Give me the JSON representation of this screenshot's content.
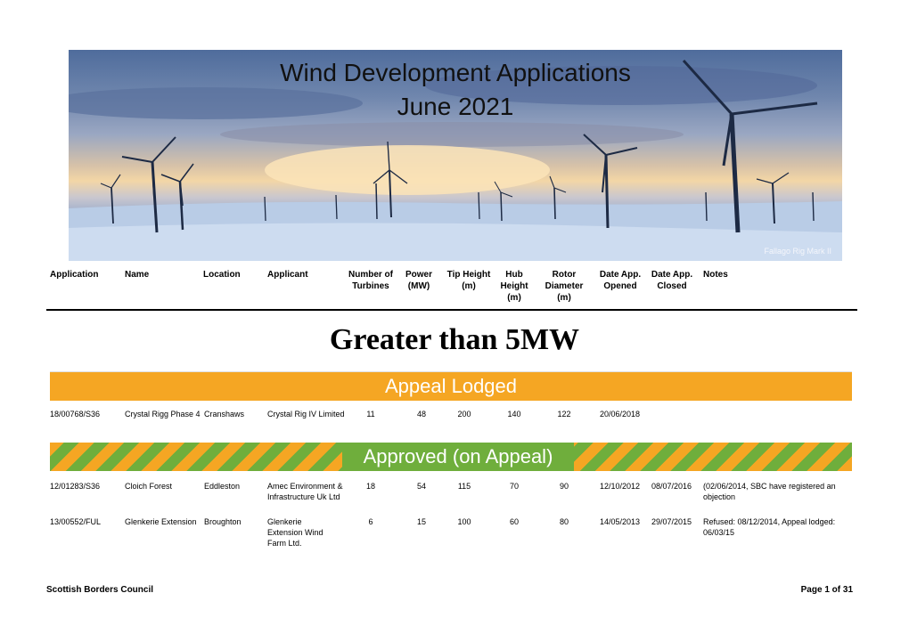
{
  "banner": {
    "title_line1": "Wind Development Applications",
    "title_line2": "June 2021",
    "caption": "Fallago Rig Mark II"
  },
  "columns": {
    "application": "Application",
    "name": "Name",
    "location": "Location",
    "applicant": "Applicant",
    "turbines": "Number of Turbines",
    "power": "Power (MW)",
    "tip": "Tip Height (m)",
    "hub": "Hub Height (m)",
    "rotor": "Rotor Diameter (m)",
    "opened": "Date App. Opened",
    "closed": "Date App. Closed",
    "notes": "Notes"
  },
  "section_title": "Greater than 5MW",
  "groups": [
    {
      "label": "Appeal Lodged",
      "rows": [
        {
          "application": "18/00768/S36",
          "name": "Crystal Rigg Phase 4",
          "location": "Cranshaws",
          "applicant": "Crystal Rig IV Limited",
          "turbines": "11",
          "power": "48",
          "tip": "200",
          "hub": "140",
          "rotor": "122",
          "opened": "20/06/2018",
          "closed": "",
          "notes": ""
        }
      ]
    },
    {
      "label": "Approved (on Appeal)",
      "rows": [
        {
          "application": "12/01283/S36",
          "name": "Cloich Forest",
          "location": "Eddleston",
          "applicant": "Amec Environment & Infrastructure Uk Ltd",
          "turbines": "18",
          "power": "54",
          "tip": "115",
          "hub": "70",
          "rotor": "90",
          "opened": "12/10/2012",
          "closed": "08/07/2016",
          "notes": "(02/06/2014, SBC have registered an objection"
        },
        {
          "application": "13/00552/FUL",
          "name": "Glenkerie Extension",
          "location": "Broughton",
          "applicant": "Glenkerie Extension Wind Farm Ltd.",
          "turbines": "6",
          "power": "15",
          "tip": "100",
          "hub": "60",
          "rotor": "80",
          "opened": "14/05/2013",
          "closed": "29/07/2015",
          "notes": "Refused: 08/12/2014, Appeal lodged: 06/03/15"
        }
      ]
    }
  ],
  "footer": {
    "left": "Scottish Borders Council",
    "right": "Page 1 of 31"
  },
  "colors": {
    "orange": "#f5a623",
    "green": "#6fae3c"
  }
}
